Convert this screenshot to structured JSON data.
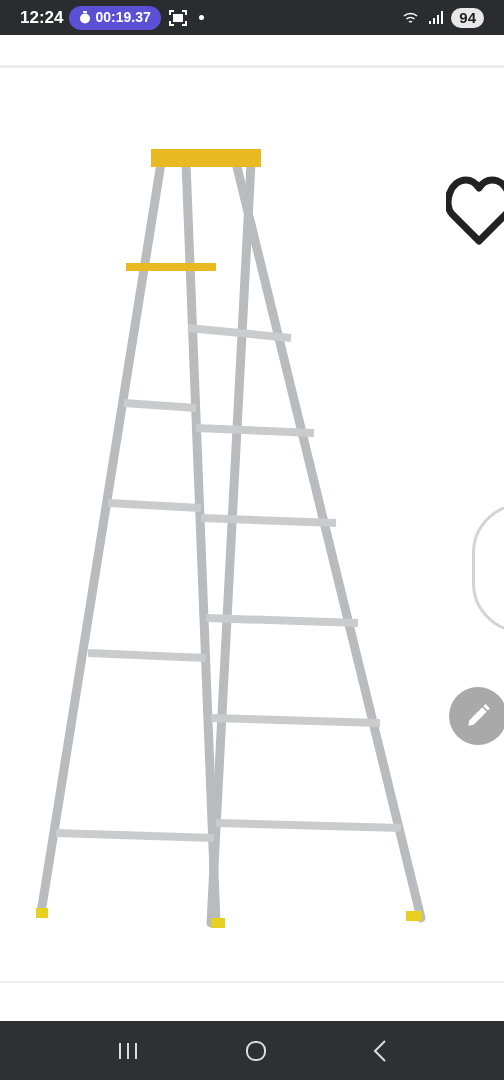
{
  "status_bar": {
    "time": "12:24",
    "timer": "00:19.37",
    "battery": "94"
  },
  "product_image": {
    "favorite": {
      "selected": false
    }
  }
}
